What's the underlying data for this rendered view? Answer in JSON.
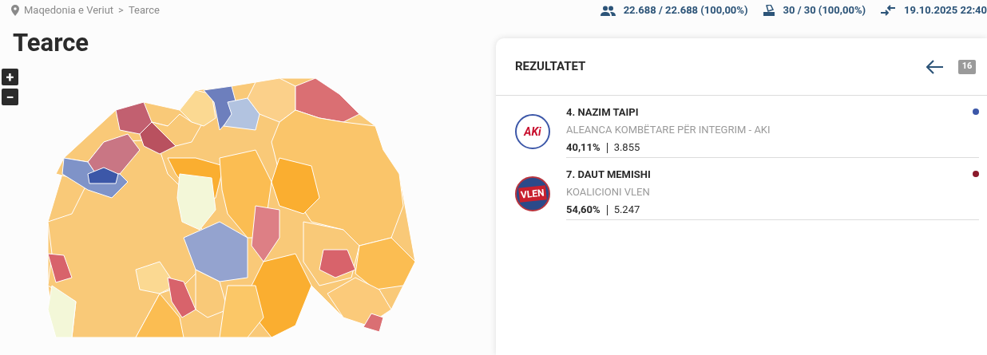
{
  "breadcrumb": {
    "items": [
      "Maqedonia e Veriut",
      "Tearce"
    ],
    "separator": ">"
  },
  "stats": [
    {
      "kind": "voters",
      "text": "22.688 / 22.688 (100,00%)"
    },
    {
      "kind": "stations",
      "text": "30 / 30 (100,00%)"
    },
    {
      "kind": "updated",
      "text": "19.10.2025 22:40"
    }
  ],
  "title": "Tearce",
  "map_controls": [
    "+",
    "−"
  ],
  "results": {
    "title": "REZULTATET",
    "count_badge": "16",
    "candidates": [
      {
        "kind": "aki",
        "logo_text": "AKi",
        "name": "4. NAZIM TAIPI",
        "party": "ALEANCA KOMBËTARE PËR INTEGRIM - AKI",
        "percent": "40,11%",
        "votes": "3.855",
        "color": "#3c57a8"
      },
      {
        "kind": "vlen",
        "logo_text": "VLEN",
        "name": "7. DAUT MEMISHI",
        "party": "KOALICIONI VLEN",
        "percent": "54,60%",
        "votes": "5.247",
        "color": "#8b1a2b"
      }
    ]
  }
}
